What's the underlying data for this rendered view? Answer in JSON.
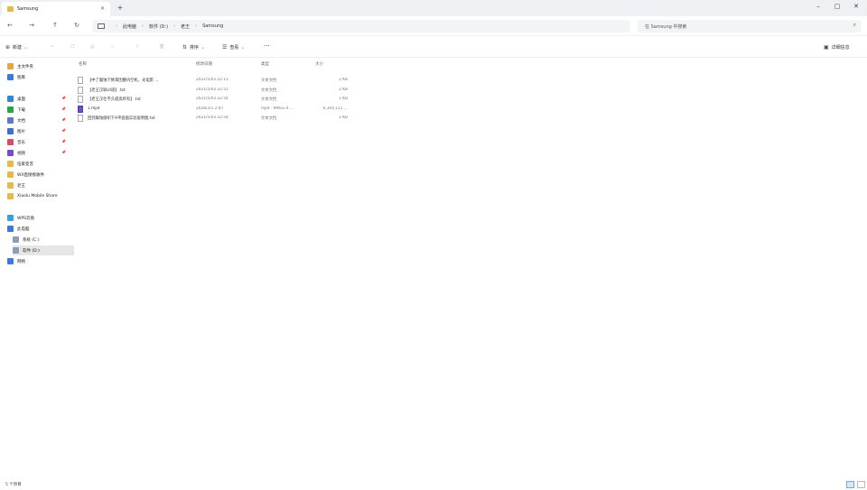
{
  "window": {
    "tab_title": "Samsung",
    "tab_close": "×",
    "new_tab": "+",
    "minimize": "–",
    "maximize": "▢",
    "close": "✕"
  },
  "address": {
    "back": "←",
    "forward": "→",
    "up": "↑",
    "refresh": "↻",
    "crumbs": [
      "此电脑",
      "软件 (D:)",
      "老王",
      "Samsung"
    ],
    "search_placeholder": "在 Samsung 中搜索"
  },
  "toolbar": {
    "new_label": "新建",
    "sort_label": "排序",
    "view_label": "查看",
    "more": "···",
    "details_label": "详细信息"
  },
  "sidebar": {
    "items": [
      {
        "label": "主文件夹",
        "color": "#e0a84a"
      },
      {
        "label": "图库",
        "color": "#3a7bd5"
      },
      {
        "label": "桌面",
        "color": "#2d8ad8",
        "pin": true
      },
      {
        "label": "下载",
        "color": "#2aa34a",
        "pin": true
      },
      {
        "label": "文档",
        "color": "#5b7cc4",
        "pin": true
      },
      {
        "label": "图片",
        "color": "#3d6fd1",
        "pin": true
      },
      {
        "label": "音乐",
        "color": "#d44d6a",
        "pin": true
      },
      {
        "label": "视频",
        "color": "#7a4bc4",
        "pin": true
      },
      {
        "label": "伍家变音",
        "color": "#e8b84a"
      },
      {
        "label": "WX直接接收件",
        "color": "#e8b84a"
      },
      {
        "label": "老王",
        "color": "#e8b84a"
      },
      {
        "label": "Xiaolu Mobile Share",
        "color": "#e8b84a"
      },
      {
        "label": "WPS云盘",
        "color": "#3aa0e0"
      },
      {
        "label": "此电脑",
        "color": "#3a7bd5"
      },
      {
        "label": "系统 (C:)",
        "color": "#8aa0b8"
      },
      {
        "label": "软件 (D:)",
        "color": "#8aa0b8",
        "selected": true
      },
      {
        "label": "网络",
        "color": "#3a7bd5"
      }
    ]
  },
  "list": {
    "headers": {
      "name": "名称",
      "date": "修改日期",
      "type": "类型",
      "size": "大小"
    },
    "rows": [
      {
        "name": "【中了腐蚀下致耳团腰内空机，光电影 ...",
        "date": "2021/5/03 22:11",
        "type": "文本文档",
        "size": "2 KB",
        "kind": "txt"
      },
      {
        "name": "【老王汉缺UI道】.txt",
        "date": "2021/5/03 22:51",
        "type": "文本文档",
        "size": "2 KB",
        "kind": "txt"
      },
      {
        "name": "【老王汉仕不久提高所有】.txt",
        "date": "2021/5/03 22:54",
        "type": "文本文档",
        "size": "1 KB",
        "kind": "txt"
      },
      {
        "name": "1.mp4",
        "date": "2026/3/1 2:47",
        "type": "mp4 - MPEG-4 ...",
        "size": "6,304,111 ...",
        "kind": "video"
      },
      {
        "name": "回到腐蚀旗帜下A平面面实验说明图.txt",
        "date": "2021/5/03 22:54",
        "type": "文本文档",
        "size": "1 KB",
        "kind": "txt"
      }
    ]
  },
  "status": {
    "text": "5 个项目"
  }
}
